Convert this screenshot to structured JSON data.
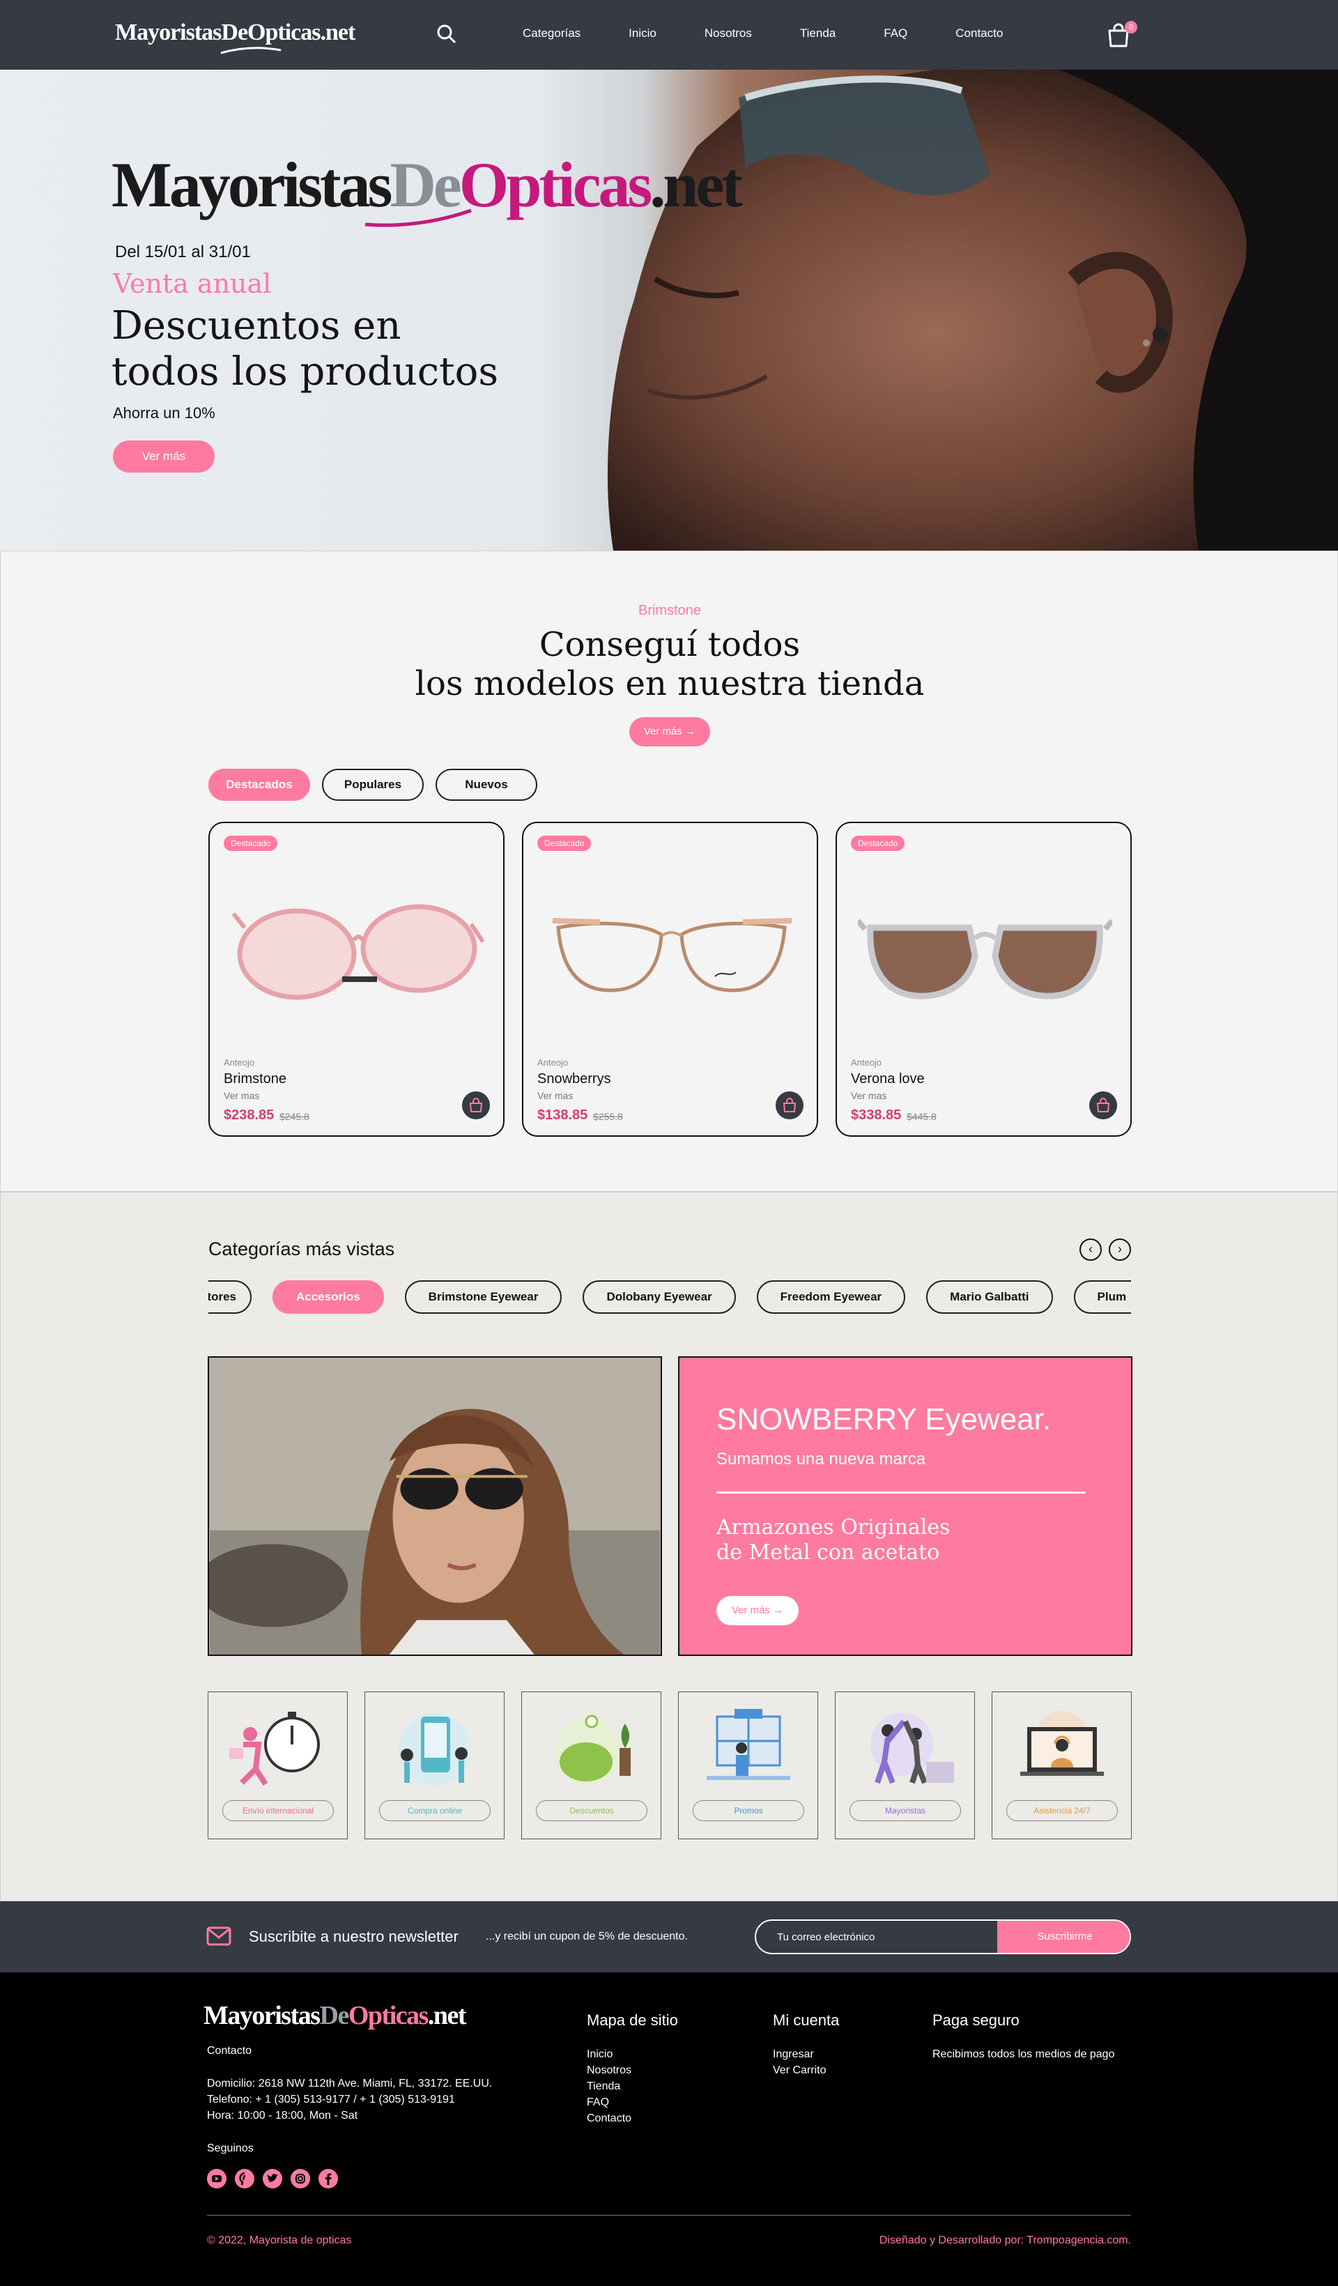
{
  "colors": {
    "accent": "#ff7aa0",
    "dark": "#353a43",
    "price": "#d43d6e"
  },
  "nav": {
    "logo": "MayoristasDeOpticas.net",
    "links": [
      "Categorías",
      "Inicio",
      "Nosotros",
      "Tienda",
      "FAQ",
      "Contacto"
    ],
    "cart_count": "0",
    "icons": [
      "search-icon",
      "shopping-bag-icon"
    ]
  },
  "hero": {
    "logo_part1": "Mayoristas",
    "logo_part2": "De",
    "logo_part3": "Opticas",
    "logo_part4": ".net",
    "date": "Del 15/01 al 31/01",
    "kicker": "Venta anual",
    "title_line1": "Descuentos en",
    "title_line2": "todos los productos",
    "subtitle": "Ahorra un 10%",
    "button": "Ver más"
  },
  "shop": {
    "kicker": "Brimstone",
    "title_line1": "Conseguí todos",
    "title_line2": "los modelos en nuestra tienda",
    "button": "Ver más →",
    "tabs": [
      "Destacados",
      "Populares",
      "Nuevos"
    ],
    "active_tab": "Destacados",
    "products": [
      {
        "badge": "Destacado",
        "category": "Anteojo",
        "name": "Brimstone",
        "more": "Ver mas",
        "price": "$238.85",
        "old_price": "$245.8"
      },
      {
        "badge": "Destacado",
        "category": "Anteojo",
        "name": "Snowberrys",
        "more": "Ver mas",
        "price": "$138.85",
        "old_price": "$255.8"
      },
      {
        "badge": "Destacado",
        "category": "Anteojo",
        "name": "Verona love",
        "more": "Ver mas",
        "price": "$338.85",
        "old_price": "$445.8"
      }
    ]
  },
  "categories": {
    "title": "Categorías más vistas",
    "prev": "‹",
    "next": "›",
    "pills": [
      "Lentes de sol y Lectores",
      "Accesorios",
      "Brimstone Eyewear",
      "Dolobany Eyewear",
      "Freedom Eyewear",
      "Mario Galbatti",
      "Plum"
    ],
    "active_pill": "Accesorios",
    "promo": {
      "brand": "SNOWBERRY Eyewear.",
      "subtitle": "Sumamos una nueva marca",
      "desc_line1": "Armazones Originales",
      "desc_line2": "de Metal con acetato",
      "button": "Ver más →"
    },
    "services": [
      {
        "label": "Envío internacional",
        "color": "#e86a9a"
      },
      {
        "label": "Compra online",
        "color": "#54b7c9"
      },
      {
        "label": "Descuentos",
        "color": "#8fc24a"
      },
      {
        "label": "Promos",
        "color": "#4a90d9"
      },
      {
        "label": "Mayoristas",
        "color": "#8a6fd1"
      },
      {
        "label": "Asistencia 24/7",
        "color": "#e09a4a"
      }
    ]
  },
  "newsletter": {
    "title": "Suscribite a nuestro newsletter",
    "subtitle": "...y recibí un cupon de 5% de descuento.",
    "placeholder": "Tu correo electrónico",
    "button": "Suscribirme"
  },
  "footer": {
    "logo_part1": "Mayoristas",
    "logo_part2": "De",
    "logo_part3": "Opticas",
    "logo_part4": ".net",
    "contact_heading": "Contacto",
    "address": "Domicilio: 2618 NW 112th Ave. Miami, FL, 33172. EE.UU.",
    "phone": "Telefono: + 1 (305) 513-9177 / + 1 (305) 513-9191",
    "hours": "Hora: 10:00 - 18:00, Mon - Sat",
    "follow": "Seguinos",
    "social_icons": [
      "youtube-icon",
      "pinterest-icon",
      "twitter-icon",
      "instagram-icon",
      "facebook-icon"
    ],
    "sitemap_heading": "Mapa de sitio",
    "sitemap": [
      "Inicio",
      "Nosotros",
      "Tienda",
      "FAQ",
      "Contacto"
    ],
    "account_heading": "Mi cuenta",
    "account": [
      "Ingresar",
      "Ver Carrito"
    ],
    "pay_heading": "Paga seguro",
    "pay_text": "Recibimos todos los medios de pago",
    "copyright": "© 2022, Mayorista de opticas",
    "credit": "Diseñado y Desarrollado por: Trompoagencia.com."
  }
}
